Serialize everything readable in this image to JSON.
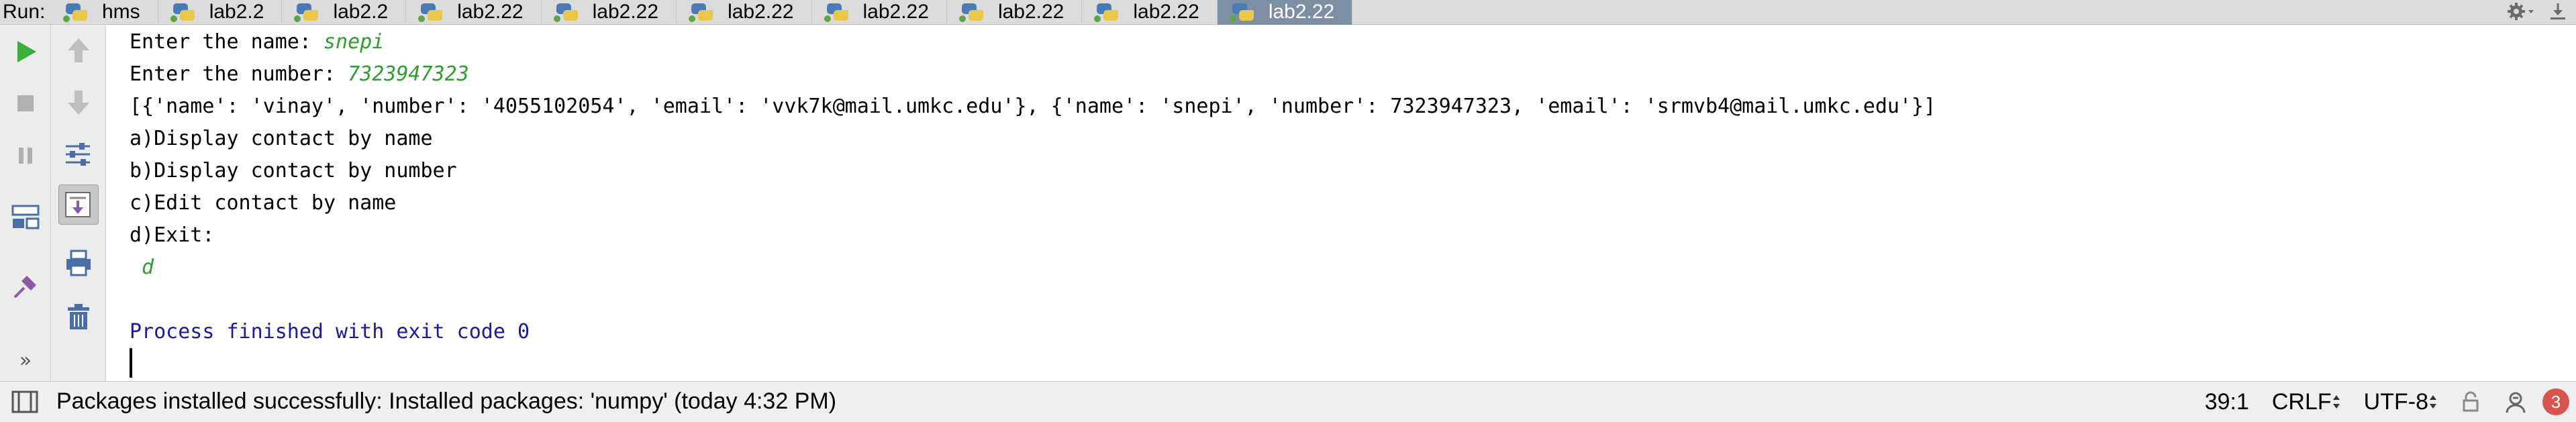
{
  "run": {
    "label": "Run:",
    "tabs": [
      {
        "label": "hms",
        "active": false
      },
      {
        "label": "lab2.2",
        "active": false
      },
      {
        "label": "lab2.2",
        "active": false
      },
      {
        "label": "lab2.22",
        "active": false
      },
      {
        "label": "lab2.22",
        "active": false
      },
      {
        "label": "lab2.22",
        "active": false
      },
      {
        "label": "lab2.22",
        "active": false
      },
      {
        "label": "lab2.22",
        "active": false
      },
      {
        "label": "lab2.22",
        "active": false
      },
      {
        "label": "lab2.22",
        "active": true
      }
    ]
  },
  "toolbar": {
    "left": [
      "run-icon",
      "stop-icon",
      "pause-icon",
      "layout-icon",
      "pin-icon",
      "more-icon"
    ],
    "right": [
      "up-icon",
      "down-icon",
      "settings-toggle-icon",
      "scroll-to-end-icon",
      "print-icon",
      "trash-icon"
    ],
    "more_label": "»"
  },
  "console": {
    "line1_prompt": "Enter the name: ",
    "line1_input": "snepi",
    "line2_prompt": "Enter the number: ",
    "line2_input": "7323947323",
    "line3": "[{'name': 'vinay', 'number': '4055102054', 'email': 'vvk7k@mail.umkc.edu'}, {'name': 'snepi', 'number': 7323947323, 'email': 'srmvb4@mail.umkc.edu'}]",
    "line4": "a)Display contact by name",
    "line5": "b)Display contact by number",
    "line6": "c)Edit contact by name",
    "line7": "d)Exit:",
    "line8_input": " d",
    "line10": "Process finished with exit code 0"
  },
  "statusbar": {
    "message": "Packages installed successfully: Installed packages: 'numpy' (today 4:32 PM)",
    "position": "39:1",
    "line_separator": "CRLF",
    "encoding": "UTF-8",
    "notifications": "3"
  },
  "colors": {
    "input_text": "#2e9e2e",
    "process_text": "#1b1b9f",
    "active_tab": "#7e8fa5",
    "run_green": "#3cae3c"
  }
}
